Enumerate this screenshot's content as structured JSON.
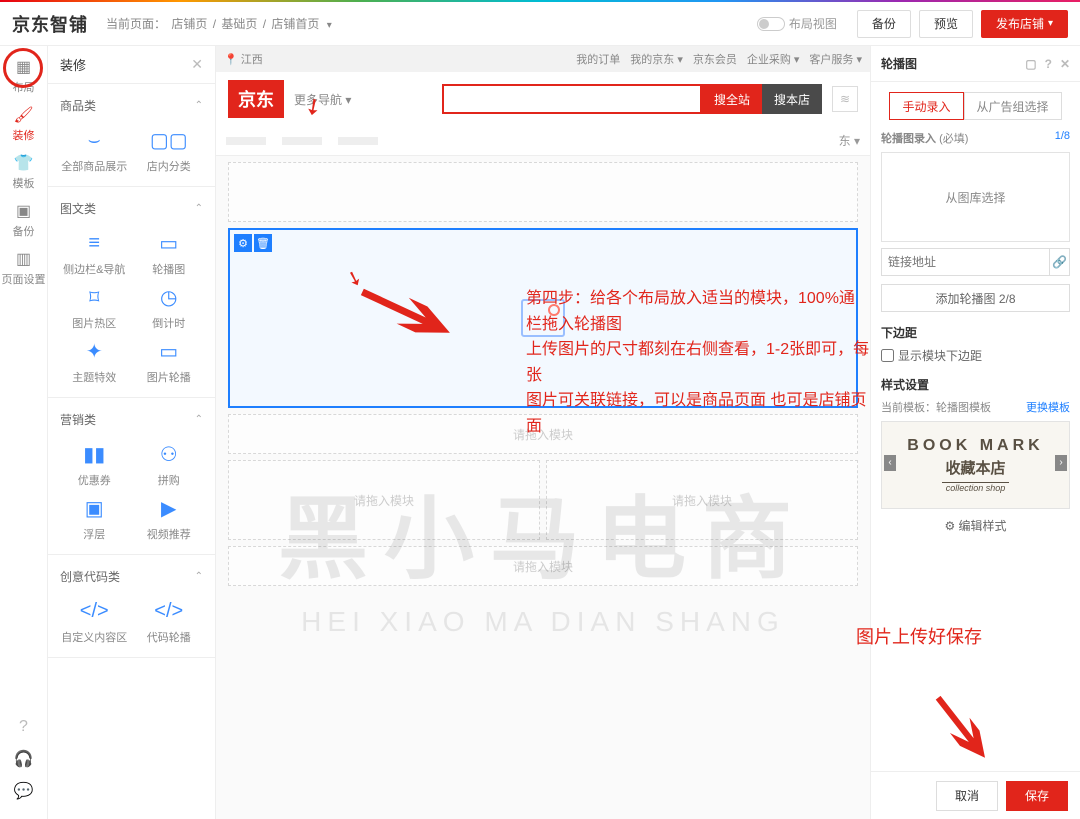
{
  "header": {
    "logo": "京东智铺",
    "crumb_label": "当前页面：",
    "crumb1": "店铺页",
    "crumb2": "基础页",
    "crumb3": "店铺首页",
    "toggle": "布局视图",
    "backup": "备份",
    "preview": "预览",
    "publish": "发布店铺"
  },
  "iconbar": {
    "layout": "布局",
    "decorate": "装修",
    "template": "模板",
    "backup": "备份",
    "page": "页面设置"
  },
  "acc": {
    "title": "装修",
    "sec_goods": "商品类",
    "goods": [
      {
        "label": "全部商品展示"
      },
      {
        "label": "店内分类"
      }
    ],
    "sec_imgtext": "图文类",
    "imgtext": [
      {
        "label": "侧边栏&导航"
      },
      {
        "label": "轮播图"
      },
      {
        "label": "图片热区"
      },
      {
        "label": "倒计时"
      },
      {
        "label": "主题特效"
      },
      {
        "label": "图片轮播"
      }
    ],
    "sec_market": "营销类",
    "market": [
      {
        "label": "优惠券"
      },
      {
        "label": "拼购"
      },
      {
        "label": "浮层"
      },
      {
        "label": "视频推荐"
      }
    ],
    "sec_code": "创意代码类",
    "code": [
      {
        "label": "自定义内容区"
      },
      {
        "label": "代码轮播"
      }
    ]
  },
  "jd": {
    "loc": "江西",
    "my_order": "我的订单",
    "my_jd": "我的京东",
    "svc": "京东会员",
    "biz": "企业采购",
    "cs": "客户服务",
    "logo": "京东",
    "more": "更多导航",
    "search_all": "搜全站",
    "search_shop": "搜本店",
    "nav_end": "东",
    "drag": "请拖入模块"
  },
  "ann": {
    "step": "第四步：给各个布局放入适当的模块，100%通栏拖入轮播图",
    "l2": "上传图片的尺寸都刻在右侧查看，1-2张即可，每张",
    "l3": "图片可关联链接，可以是商品页面  也可是店铺页面",
    "save": "图片上传好保存"
  },
  "wm": {
    "cn": "黑小马电商",
    "en": "HEI XIAO MA DIAN SHANG"
  },
  "right": {
    "title": "轮播图",
    "tab1": "手动录入",
    "tab2": "从广告组选择",
    "entry": "轮播图录入",
    "required": "(必填)",
    "count": "1/8",
    "pick": "从图库选择",
    "link_ph": "链接地址",
    "add": "添加轮播图 2/8",
    "margin_t": "下边距",
    "margin_chk": "显示模块下边距",
    "style_t": "样式设置",
    "cur_tpl": "当前模板：",
    "tpl_name": "轮播图模板",
    "change": "更换模板",
    "bm_en": "BOOK MARK",
    "bm_cn": "收藏本店",
    "bm_sub": "collection shop",
    "edit": "编辑样式",
    "cancel": "取消",
    "save": "保存"
  }
}
